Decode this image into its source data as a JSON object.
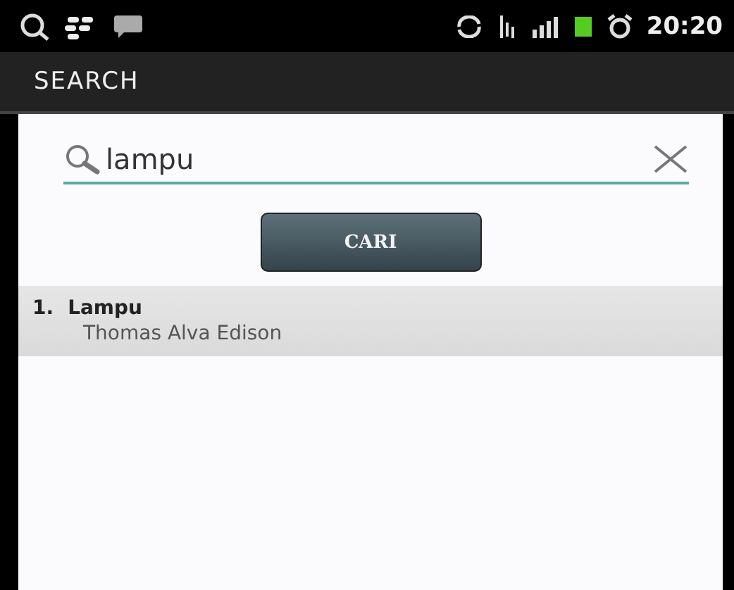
{
  "status_bar": {
    "time": "20:20"
  },
  "action_bar": {
    "title": "SEARCH"
  },
  "search": {
    "value": "lampu"
  },
  "button": {
    "label": "CARI"
  },
  "results": [
    {
      "index": "1.",
      "title": "Lampu",
      "subtitle": "Thomas Alva Edison"
    }
  ]
}
